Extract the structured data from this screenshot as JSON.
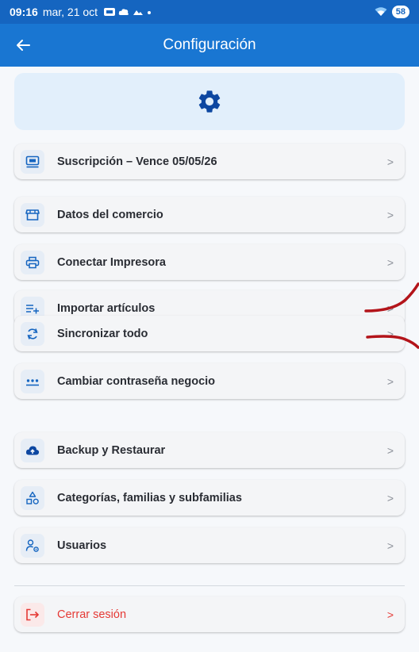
{
  "status_bar": {
    "time": "09:16",
    "date": "mar, 21 oct",
    "battery": "58"
  },
  "app_bar": {
    "title": "Configuración"
  },
  "menu": {
    "items": [
      {
        "label": "Suscripción – Vence 05/05/26",
        "icon": "card-icon"
      },
      {
        "label": "Datos del comercio",
        "icon": "store-icon"
      },
      {
        "label": "Conectar Impresora",
        "icon": "printer-icon"
      },
      {
        "label": "Importar artículos",
        "icon": "list-add-icon"
      },
      {
        "label": "Sincronizar todo",
        "icon": "sync-icon"
      },
      {
        "label": "Cambiar contraseña negocio",
        "icon": "password-icon"
      },
      {
        "label": "Backup y Restaurar",
        "icon": "cloud-upload-icon"
      },
      {
        "label": "Categorías, familias y subfamilias",
        "icon": "categories-icon"
      },
      {
        "label": "Usuarios",
        "icon": "users-settings-icon"
      }
    ],
    "logout_label": "Cerrar sesión",
    "chevron": ">"
  },
  "colors": {
    "status_bar": "#1565c0",
    "app_bar": "#1976d2",
    "accent": "#1565c0",
    "danger": "#e53935",
    "annotation": "#b3141a"
  }
}
